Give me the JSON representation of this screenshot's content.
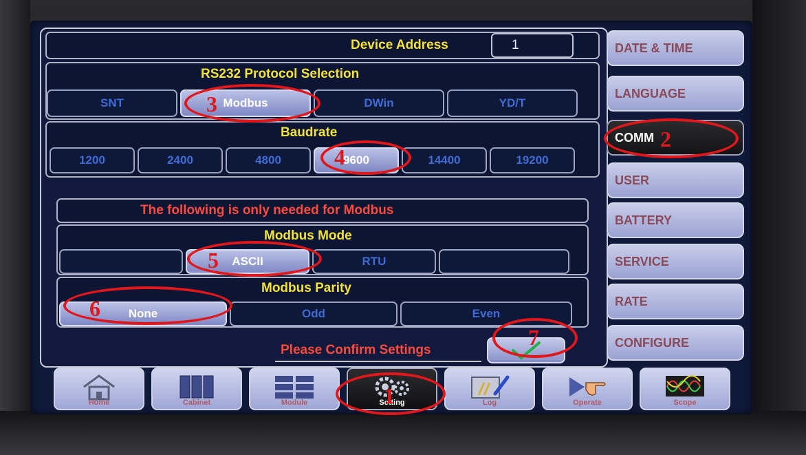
{
  "device_address": {
    "label": "Device Address",
    "value": "1"
  },
  "protocol": {
    "title": "RS232 Protocol Selection",
    "options": [
      "SNT",
      "Modbus",
      "DWin",
      "YD/T"
    ],
    "selected": "Modbus"
  },
  "baudrate": {
    "title": "Baudrate",
    "options": [
      "1200",
      "2400",
      "4800",
      "9600",
      "14400",
      "19200"
    ],
    "selected": "9600"
  },
  "modbus_note": "The following is only needed for Modbus",
  "modbus_mode": {
    "title": "Modbus Mode",
    "options": [
      "",
      "ASCII",
      "RTU",
      ""
    ],
    "selected": "ASCII"
  },
  "modbus_parity": {
    "title": "Modbus Parity",
    "options": [
      "None",
      "Odd",
      "Even"
    ],
    "selected": "None"
  },
  "confirm": {
    "label": "Please Confirm Settings",
    "icon": "check-icon"
  },
  "side_tabs": [
    "DATE & TIME",
    "LANGUAGE",
    "COMM",
    "USER",
    "BATTERY",
    "SERVICE",
    "RATE",
    "CONFIGURE"
  ],
  "active_side_tab": "COMM",
  "bottom_nav": [
    "Home",
    "Cabinet",
    "Module",
    "Setting",
    "Log",
    "Operate",
    "Scope"
  ],
  "active_bottom_nav": "Setting",
  "annotations": [
    "1",
    "2",
    "3",
    "4",
    "5",
    "6",
    "7"
  ],
  "colors": {
    "annotation": "#e0181b",
    "title_yellow": "#f4e23a",
    "note_red": "#ff4a3d",
    "option_blue": "#3f6bd6",
    "selected_bg": "#8f98cf"
  }
}
